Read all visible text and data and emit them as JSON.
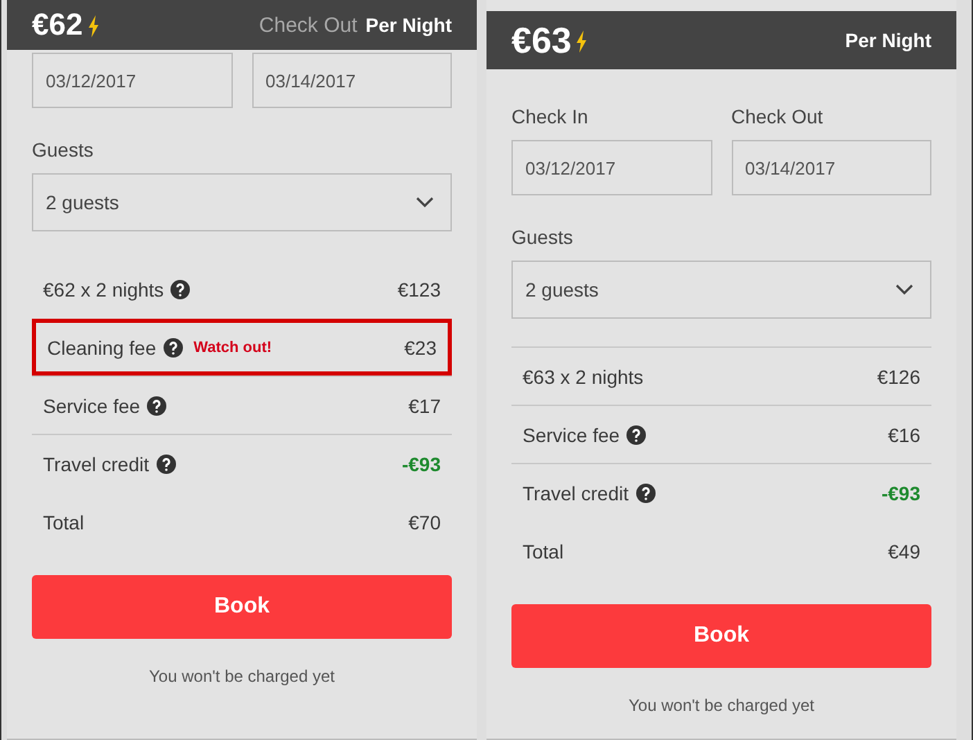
{
  "panels": [
    {
      "price": "€62",
      "per_night": "Per Night",
      "behind_text": "Check Out",
      "clipped": true,
      "dates": [
        {
          "value": "03/12/2017"
        },
        {
          "value": "03/14/2017"
        }
      ],
      "guests_label": "Guests",
      "guests": "2 guests",
      "lines": [
        {
          "label": "€62 x 2 nights",
          "help": true,
          "value": "€123",
          "credit": false,
          "highlighted": false,
          "divider": false
        },
        {
          "label": "Cleaning fee",
          "help": true,
          "warning": "Watch out!",
          "value": "€23",
          "credit": false,
          "highlighted": true,
          "divider": false
        },
        {
          "label": "Service fee",
          "help": true,
          "value": "€17",
          "credit": false,
          "highlighted": false,
          "divider": true
        },
        {
          "label": "Travel credit",
          "help": true,
          "value": "-€93",
          "credit": true,
          "highlighted": false,
          "divider": true
        },
        {
          "label": "Total",
          "help": false,
          "value": "€70",
          "credit": false,
          "highlighted": false,
          "divider": false
        }
      ],
      "button": "Book",
      "note": "You won't be charged yet"
    },
    {
      "price": "€63",
      "per_night": "Per Night",
      "clipped": false,
      "dates": [
        {
          "label": "Check In",
          "value": "03/12/2017"
        },
        {
          "label": "Check Out",
          "value": "03/14/2017"
        }
      ],
      "guests_label": "Guests",
      "guests": "2 guests",
      "lines": [
        {
          "label": "€63 x 2 nights",
          "help": false,
          "value": "€126",
          "credit": false,
          "highlighted": false,
          "divider": true
        },
        {
          "label": "Service fee",
          "help": true,
          "value": "€16",
          "credit": false,
          "highlighted": false,
          "divider": true
        },
        {
          "label": "Travel credit",
          "help": true,
          "value": "-€93",
          "credit": true,
          "highlighted": false,
          "divider": true
        },
        {
          "label": "Total",
          "help": false,
          "value": "€49",
          "credit": false,
          "highlighted": false,
          "divider": false
        }
      ],
      "button": "Book",
      "note": "You won't be charged yet"
    }
  ]
}
